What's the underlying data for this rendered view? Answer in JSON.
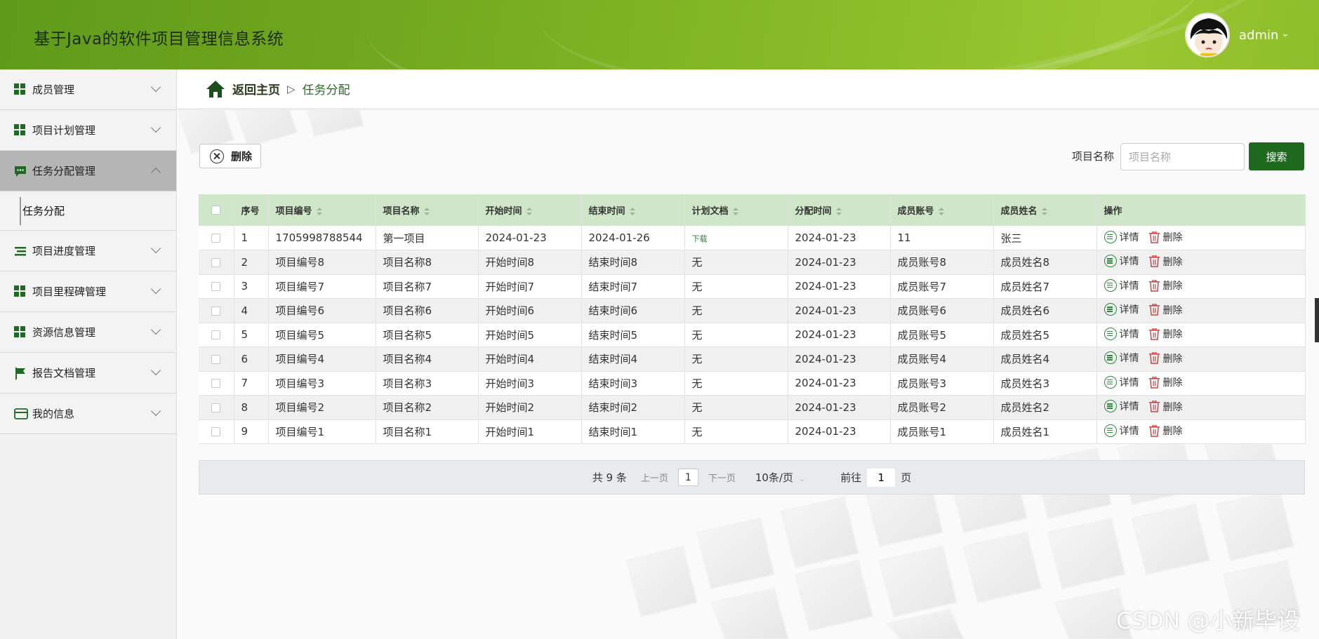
{
  "header": {
    "title": "基于Java的软件项目管理信息系统",
    "user_name": "admin",
    "user_caret": "⌄"
  },
  "sidebar": {
    "items": [
      {
        "label": "成员管理",
        "icon": "grid-icon"
      },
      {
        "label": "项目计划管理",
        "icon": "grid-icon"
      },
      {
        "label": "任务分配管理",
        "icon": "chat-icon"
      },
      {
        "label": "项目进度管理",
        "icon": "list-icon"
      },
      {
        "label": "项目里程碑管理",
        "icon": "grid-icon"
      },
      {
        "label": "资源信息管理",
        "icon": "grid-icon"
      },
      {
        "label": "报告文档管理",
        "icon": "flag-icon"
      },
      {
        "label": "我的信息",
        "icon": "card-icon"
      }
    ],
    "sub_item": "任务分配"
  },
  "breadcrumb": {
    "home": "返回主页",
    "separator": "▷",
    "current": "任务分配"
  },
  "toolbar": {
    "delete_label": "删除",
    "search_label": "项目名称",
    "search_placeholder": "项目名称",
    "search_button": "搜索"
  },
  "table": {
    "headers": [
      "序号",
      "项目编号",
      "项目名称",
      "开始时间",
      "结束时间",
      "计划文档",
      "分配时间",
      "成员账号",
      "成员姓名",
      "操作"
    ],
    "rows": [
      [
        "1",
        "1705998788544",
        "第一项目",
        "2024-01-23",
        "2024-01-26",
        "下载",
        "2024-01-23",
        "11",
        "张三"
      ],
      [
        "2",
        "项目编号8",
        "项目名称8",
        "开始时间8",
        "结束时间8",
        "无",
        "2024-01-23",
        "成员账号8",
        "成员姓名8"
      ],
      [
        "3",
        "项目编号7",
        "项目名称7",
        "开始时间7",
        "结束时间7",
        "无",
        "2024-01-23",
        "成员账号7",
        "成员姓名7"
      ],
      [
        "4",
        "项目编号6",
        "项目名称6",
        "开始时间6",
        "结束时间6",
        "无",
        "2024-01-23",
        "成员账号6",
        "成员姓名6"
      ],
      [
        "5",
        "项目编号5",
        "项目名称5",
        "开始时间5",
        "结束时间5",
        "无",
        "2024-01-23",
        "成员账号5",
        "成员姓名5"
      ],
      [
        "6",
        "项目编号4",
        "项目名称4",
        "开始时间4",
        "结束时间4",
        "无",
        "2024-01-23",
        "成员账号4",
        "成员姓名4"
      ],
      [
        "7",
        "项目编号3",
        "项目名称3",
        "开始时间3",
        "结束时间3",
        "无",
        "2024-01-23",
        "成员账号3",
        "成员姓名3"
      ],
      [
        "8",
        "项目编号2",
        "项目名称2",
        "开始时间2",
        "结束时间2",
        "无",
        "2024-01-23",
        "成员账号2",
        "成员姓名2"
      ],
      [
        "9",
        "项目编号1",
        "项目名称1",
        "开始时间1",
        "结束时间1",
        "无",
        "2024-01-23",
        "成员账号1",
        "成员姓名1"
      ]
    ],
    "detail_label": "详情",
    "delete_label": "删除"
  },
  "pagination": {
    "total": "共 9 条",
    "prev": "上一页",
    "page": "1",
    "next": "下一页",
    "page_size": "10条/页",
    "goto": "前往",
    "goto_value": "1",
    "unit": "页"
  },
  "watermark": "CSDN @小新毕设",
  "colors": {
    "header_green": "#72a81f",
    "primary_green": "#1d6a1f",
    "table_header": "#d0e6c8",
    "sidebar_active": "#b5b5b5"
  }
}
